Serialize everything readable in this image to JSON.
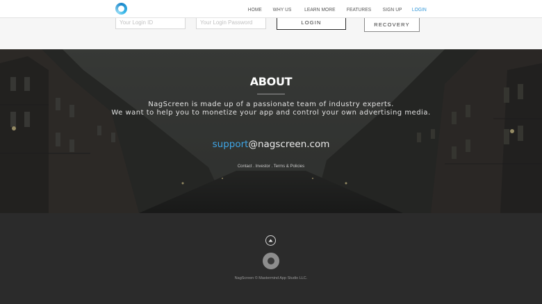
{
  "nav": {
    "links": [
      {
        "label": "HOME",
        "active": false
      },
      {
        "label": "WHY US",
        "active": false
      },
      {
        "label": "LEARN MORE",
        "active": false
      },
      {
        "label": "FEATURES",
        "active": false
      },
      {
        "label": "SIGN UP",
        "active": false
      },
      {
        "label": "LOGIN",
        "active": true
      }
    ],
    "active_color": "#2f96d8"
  },
  "login": {
    "id_placeholder": "Your Login ID",
    "password_placeholder": "Your Login Password",
    "login_label": "LOGIN",
    "recovery_label": "RECOVERY"
  },
  "about": {
    "title": "ABOUT",
    "line1": "NagScreen is made up of a passionate team of industry experts.",
    "line2": "We want to help you to monetize your app and control your own advertising media.",
    "email_accent": "support",
    "email_rest": "@nagscreen.com",
    "links": {
      "contact": "Contact",
      "sep1": " . ",
      "investor": "Investor",
      "sep2": " . ",
      "terms": "Terms & Policies"
    },
    "accent_color": "#3fa6e6"
  },
  "footer": {
    "up_icon": "chevron-up-icon",
    "logo_icon": "nagscreen-logo-icon",
    "copyright": "NagScreen © Mastermind App Studio LLC."
  }
}
